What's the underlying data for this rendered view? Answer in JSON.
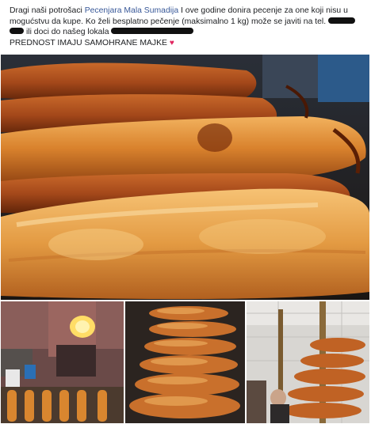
{
  "post": {
    "text_part1": "Dragi naši potrošaci ",
    "page_mention": "Pecenjara Mala Sumadija",
    "text_part2": " I ove godine donira pecenje za one koji nisu u",
    "line2": "mogućstvu da kupe. Ko želi besplatno pečenje (maksimalno 1 kg) može se javiti na tel.",
    "line3": "ili doci do našeg lokala",
    "line4": "PREDNOST IMAJU SAMOHRANE MAJKE",
    "heart_icon": "heart-icon",
    "redaction_color": "#111111"
  },
  "photos": {
    "main": "roast-pigs-closeup-photo",
    "oven": "wood-oven-photo",
    "spits": "spit-rack-photo",
    "rack": "rotisserie-rack-photo"
  },
  "colors": {
    "mention": "#385898",
    "text": "#1c1e21",
    "heart": "#e0245e"
  }
}
